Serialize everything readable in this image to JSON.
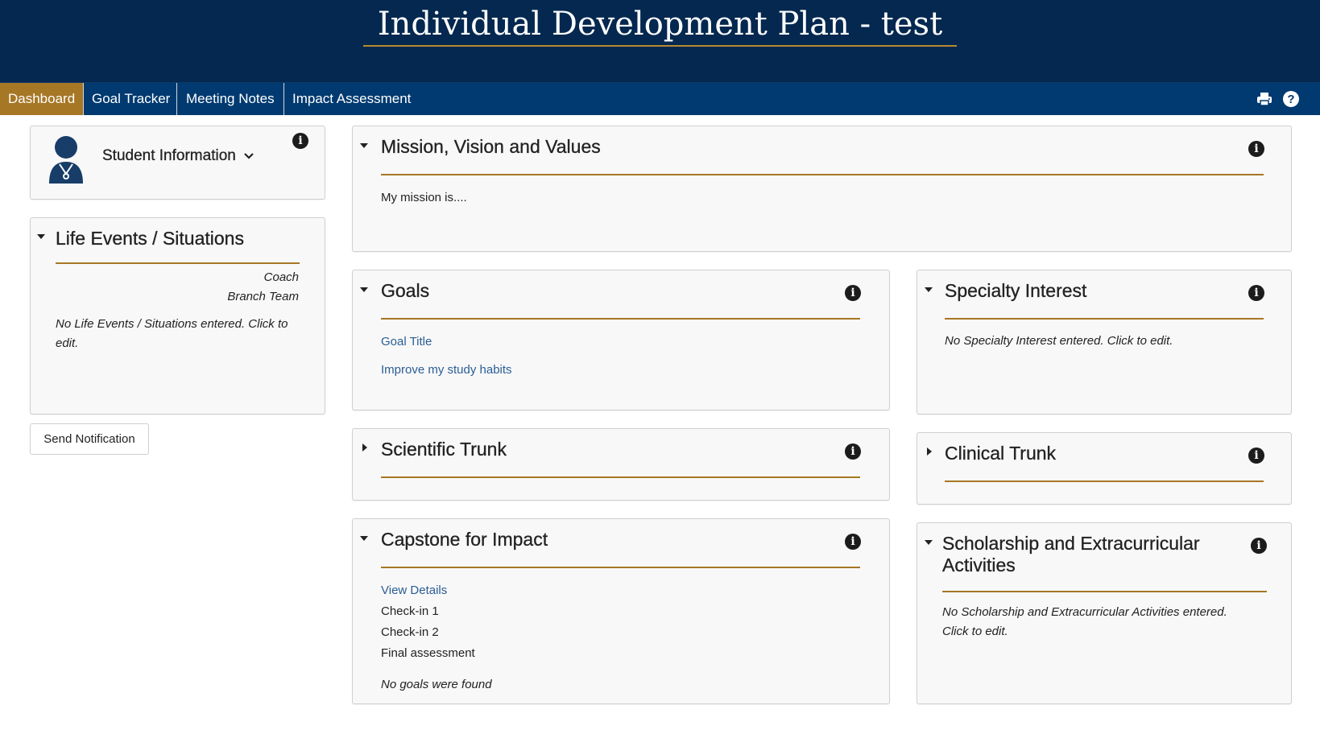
{
  "header": {
    "title": "Individual Development Plan - test"
  },
  "nav": {
    "tabs": [
      {
        "label": "Dashboard"
      },
      {
        "label": "Goal Tracker"
      },
      {
        "label": "Meeting Notes"
      },
      {
        "label": "Impact Assessment"
      }
    ],
    "icons": [
      "print-icon",
      "help-icon"
    ]
  },
  "student": {
    "label": "Student Information"
  },
  "life_events": {
    "title": "Life Events / Situations",
    "coach": "Coach",
    "branch": "Branch Team",
    "empty": "No Life Events / Situations entered. Click to edit."
  },
  "send_notification": "Send Notification",
  "mission": {
    "title": "Mission, Vision and Values",
    "text": "My mission is...."
  },
  "goals": {
    "title": "Goals",
    "header_link": "Goal Title",
    "items": [
      "Improve my study habits"
    ]
  },
  "specialty": {
    "title": "Specialty Interest",
    "empty": "No Specialty Interest entered. Click to edit."
  },
  "scientific": {
    "title": "Scientific Trunk"
  },
  "clinical": {
    "title": "Clinical Trunk"
  },
  "capstone": {
    "title": "Capstone for Impact",
    "link": "View Details",
    "items": [
      "Check-in 1",
      "Check-in 2",
      "Final assessment"
    ],
    "empty": "No goals were found"
  },
  "scholarship": {
    "title_line1": "Scholarship and Extracurricular",
    "title_line2": "Activities",
    "empty": "No Scholarship and Extracurricular Activities entered. Click to edit."
  },
  "colors": {
    "header_bg": "#04284f",
    "nav_bg": "#003a70",
    "accent": "#a67725",
    "link": "#2a5d95"
  }
}
